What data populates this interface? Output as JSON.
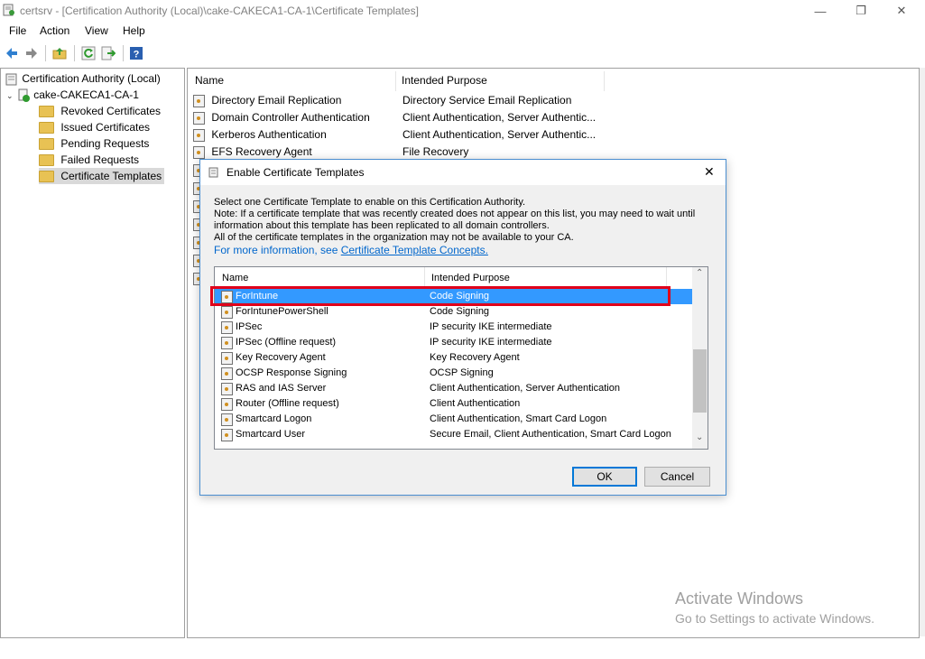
{
  "window": {
    "title": "certsrv - [Certification Authority (Local)\\cake-CAKECA1-CA-1\\Certificate Templates]",
    "minimize": "—",
    "maximize": "❐",
    "close": "✕"
  },
  "menu": [
    "File",
    "Action",
    "View",
    "Help"
  ],
  "toolbar": {
    "icons": [
      "back-icon",
      "forward-icon",
      "up-folder-icon",
      "refresh-icon",
      "export-icon",
      "help-icon"
    ]
  },
  "tree": {
    "root": "Certification Authority (Local)",
    "ca": "cake-CAKECA1-CA-1",
    "items": [
      "Revoked Certificates",
      "Issued Certificates",
      "Pending Requests",
      "Failed Requests",
      "Certificate Templates"
    ],
    "selected": "Certificate Templates"
  },
  "list": {
    "columns": [
      "Name",
      "Intended Purpose"
    ],
    "rows": [
      {
        "name": "Directory Email Replication",
        "purpose": "Directory Service Email Replication"
      },
      {
        "name": "Domain Controller Authentication",
        "purpose": "Client Authentication, Server Authentic..."
      },
      {
        "name": "Kerberos Authentication",
        "purpose": "Client Authentication, Server Authentic..."
      },
      {
        "name": "EFS Recovery Agent",
        "purpose": "File Recovery"
      }
    ]
  },
  "dialog": {
    "title": "Enable Certificate Templates",
    "close": "✕",
    "text_lines": [
      "Select one Certificate Template to enable on this Certification Authority.",
      "Note: If a certificate template that was recently created does not appear on this list, you may need to wait until",
      "information about this template has been replicated to all domain controllers.",
      "All of the certificate templates in the organization may not be available to your CA."
    ],
    "more_info_prefix": "For more information, see ",
    "more_info_link": "Certificate Template Concepts.",
    "columns": [
      "Name",
      "Intended Purpose"
    ],
    "rows": [
      {
        "name": "ForIntune",
        "purpose": "Code Signing",
        "selected": true
      },
      {
        "name": "ForIntunePowerShell",
        "purpose": "Code Signing"
      },
      {
        "name": "IPSec",
        "purpose": "IP security IKE intermediate"
      },
      {
        "name": "IPSec (Offline request)",
        "purpose": "IP security IKE intermediate"
      },
      {
        "name": "Key Recovery Agent",
        "purpose": "Key Recovery Agent"
      },
      {
        "name": "OCSP Response Signing",
        "purpose": "OCSP Signing"
      },
      {
        "name": "RAS and IAS Server",
        "purpose": "Client Authentication, Server Authentication"
      },
      {
        "name": "Router (Offline request)",
        "purpose": "Client Authentication"
      },
      {
        "name": "Smartcard Logon",
        "purpose": "Client Authentication, Smart Card Logon"
      },
      {
        "name": "Smartcard User",
        "purpose": "Secure Email, Client Authentication, Smart Card Logon"
      }
    ],
    "ok": "OK",
    "cancel": "Cancel"
  },
  "watermark": {
    "title": "Activate Windows",
    "subtitle": "Go to Settings to activate Windows."
  },
  "colors": {
    "selection": "#3399ff",
    "highlight_box": "#e0001a",
    "link": "#0066cc"
  }
}
